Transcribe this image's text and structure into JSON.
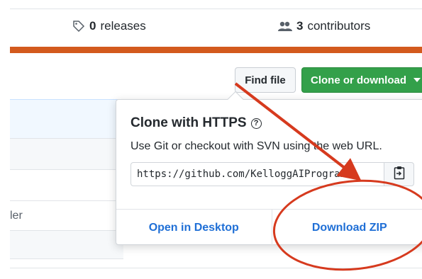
{
  "stats": {
    "releases": {
      "count": "0",
      "label": "releases",
      "icon": "tag-icon"
    },
    "contributors": {
      "count": "3",
      "label": "contributors",
      "icon": "people-icon"
    }
  },
  "colors": {
    "language_bar": "#d35a1d",
    "clone_button": "#33a04a",
    "link": "#1f6fd6",
    "annotation": "#d63a1e"
  },
  "toolbar": {
    "find_file": "Find file",
    "clone_or_download": "Clone or download"
  },
  "file_list": {
    "partial_text": "ler"
  },
  "clone_popover": {
    "title": "Clone with HTTPS",
    "help_icon": "question-circle-icon",
    "description": "Use Git or checkout with SVN using the web URL.",
    "url": "https://github.com/KelloggAIProgramme",
    "copy_icon": "clipboard-icon",
    "open_in_desktop": "Open in Desktop",
    "download_zip": "Download ZIP"
  }
}
